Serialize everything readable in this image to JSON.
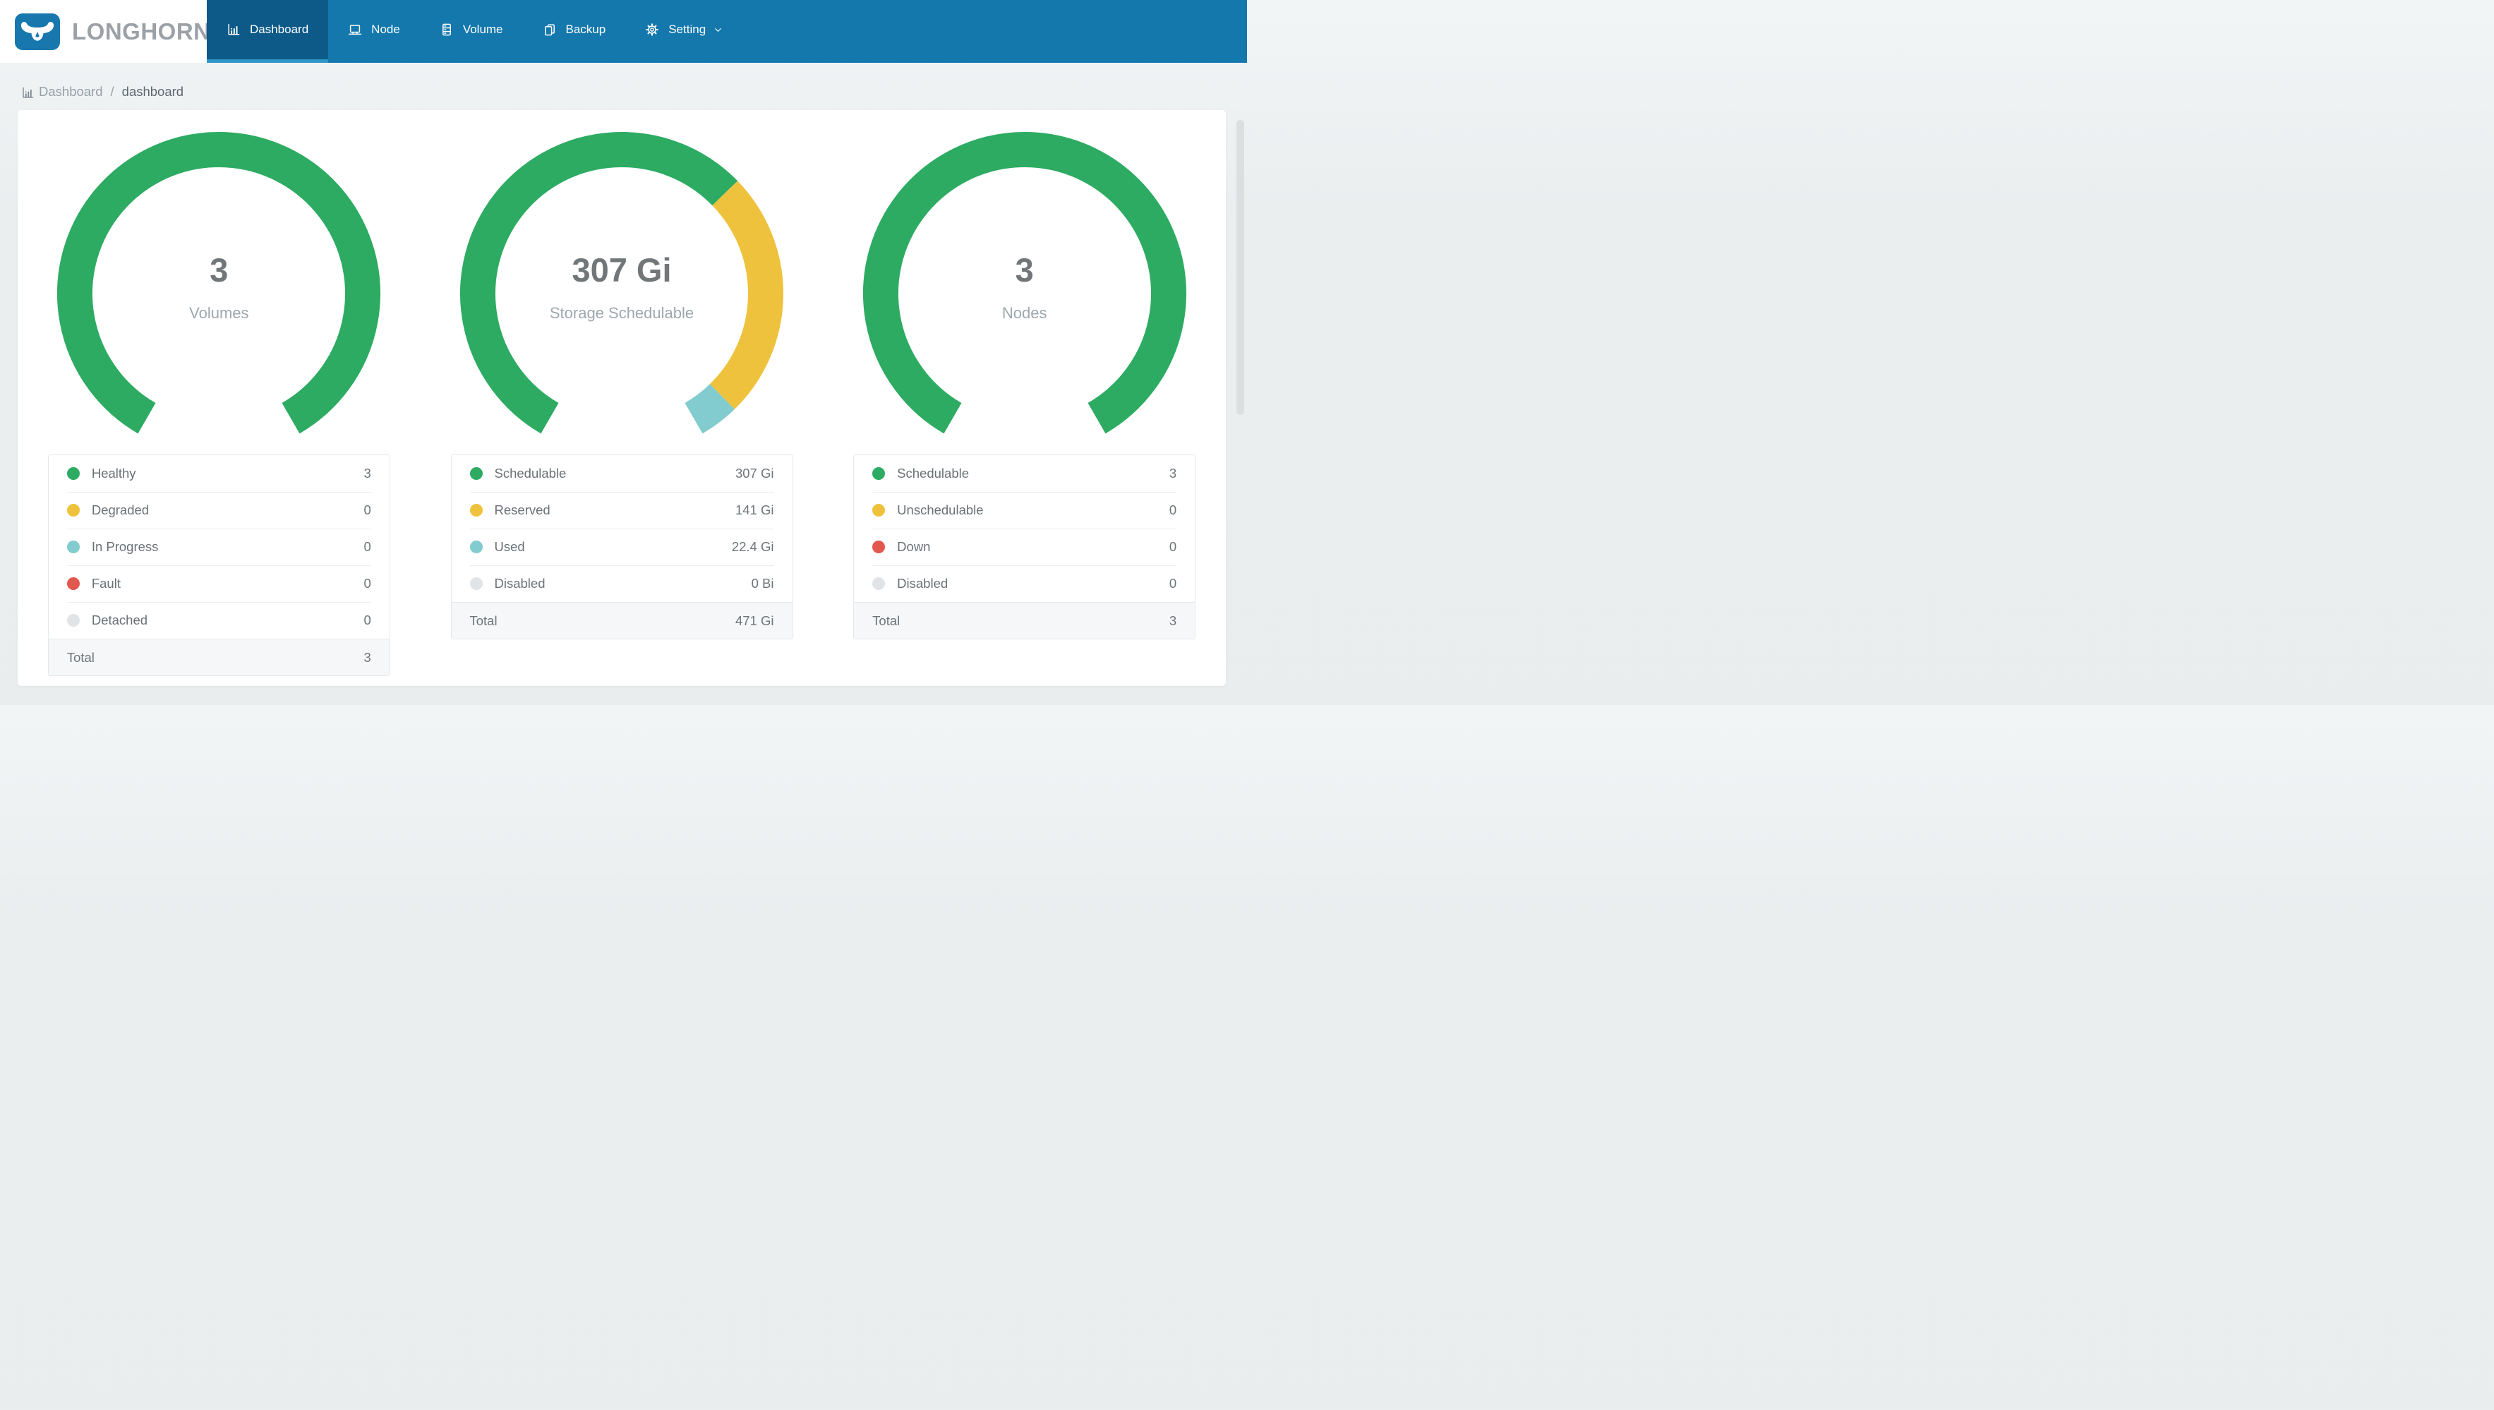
{
  "app": {
    "brand": "LONGHORN"
  },
  "nav": {
    "items": [
      {
        "label": "Dashboard",
        "icon": "bar-chart",
        "active": true
      },
      {
        "label": "Node",
        "icon": "laptop",
        "active": false
      },
      {
        "label": "Volume",
        "icon": "server",
        "active": false
      },
      {
        "label": "Backup",
        "icon": "copy",
        "active": false
      },
      {
        "label": "Setting",
        "icon": "gear",
        "active": false,
        "dropdown": true
      }
    ]
  },
  "breadcrumb": {
    "icon": "bar-chart",
    "root": "Dashboard",
    "separator": "/",
    "current": "dashboard"
  },
  "colors": {
    "navbar": "#1478ad",
    "navbar_active": "#0d5a88",
    "active_indicator": "#2f96c6",
    "logo_blue": "#1878ad",
    "green": "#2dab62",
    "yellow": "#efc23d",
    "teal": "#82cbce",
    "red": "#e2574e",
    "gray": "#e1e4e7"
  },
  "chart_data": [
    {
      "type": "donut",
      "center_value": "3",
      "center_label": "Volumes",
      "start_angle_deg": -150,
      "sweep_deg": 300,
      "rows": [
        {
          "label": "Healthy",
          "value": 3,
          "display": "3",
          "color": "green"
        },
        {
          "label": "Degraded",
          "value": 0,
          "display": "0",
          "color": "yellow"
        },
        {
          "label": "In Progress",
          "value": 0,
          "display": "0",
          "color": "teal"
        },
        {
          "label": "Fault",
          "value": 0,
          "display": "0",
          "color": "red"
        },
        {
          "label": "Detached",
          "value": 0,
          "display": "0",
          "color": "gray"
        }
      ],
      "total": {
        "label": "Total",
        "display": "3"
      }
    },
    {
      "type": "donut",
      "center_value": "307 Gi",
      "center_label": "Storage Schedulable",
      "start_angle_deg": -150,
      "sweep_deg": 300,
      "rows": [
        {
          "label": "Schedulable",
          "value": 307,
          "display": "307 Gi",
          "color": "green"
        },
        {
          "label": "Reserved",
          "value": 141,
          "display": "141 Gi",
          "color": "yellow"
        },
        {
          "label": "Used",
          "value": 22.4,
          "display": "22.4 Gi",
          "color": "teal"
        },
        {
          "label": "Disabled",
          "value": 0,
          "display": "0 Bi",
          "color": "gray"
        }
      ],
      "total": {
        "label": "Total",
        "display": "471 Gi"
      }
    },
    {
      "type": "donut",
      "center_value": "3",
      "center_label": "Nodes",
      "start_angle_deg": -150,
      "sweep_deg": 300,
      "rows": [
        {
          "label": "Schedulable",
          "value": 3,
          "display": "3",
          "color": "green"
        },
        {
          "label": "Unschedulable",
          "value": 0,
          "display": "0",
          "color": "yellow"
        },
        {
          "label": "Down",
          "value": 0,
          "display": "0",
          "color": "red"
        },
        {
          "label": "Disabled",
          "value": 0,
          "display": "0",
          "color": "gray"
        }
      ],
      "total": {
        "label": "Total",
        "display": "3"
      }
    }
  ]
}
